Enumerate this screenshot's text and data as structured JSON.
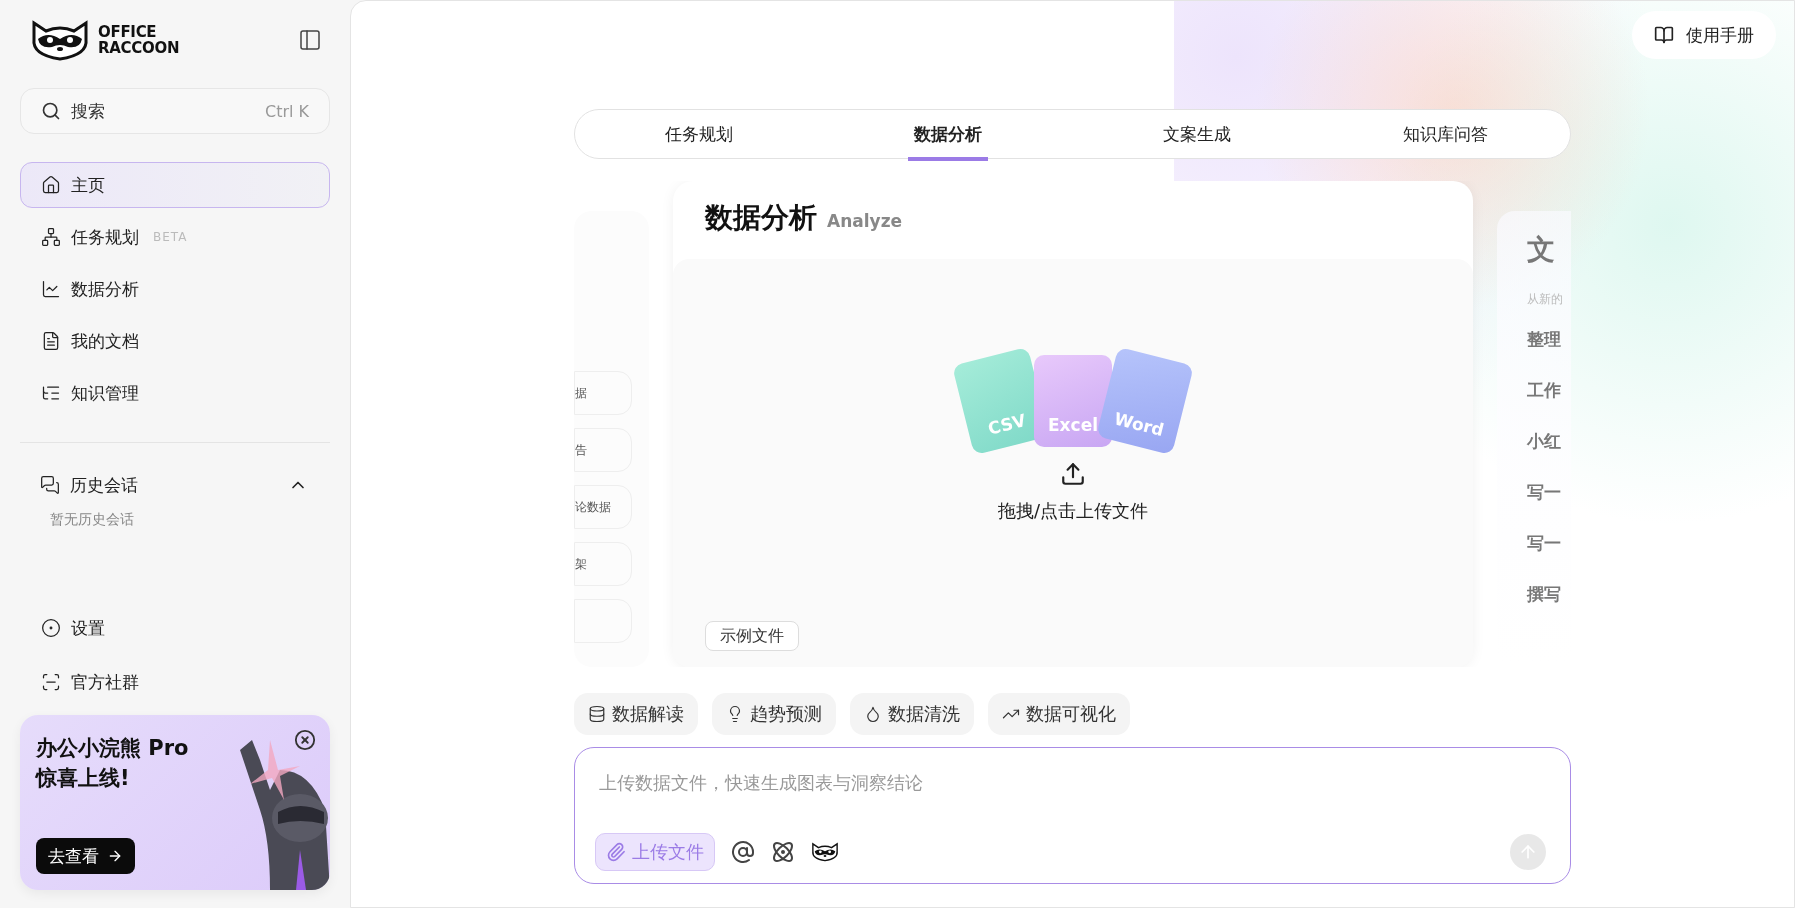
{
  "sidebar": {
    "logo": [
      "OFFICE",
      "RACCOON"
    ],
    "search": {
      "placeholder": "搜索",
      "shortcut": "Ctrl K"
    },
    "nav": [
      {
        "label": "主页",
        "selected": true
      },
      {
        "label": "任务规划",
        "selected": false,
        "badge": "BETA"
      },
      {
        "label": "数据分析",
        "selected": false
      },
      {
        "label": "我的文档",
        "selected": false
      },
      {
        "label": "知识管理",
        "selected": false
      }
    ],
    "history": {
      "title": "历史会话",
      "expanded": true,
      "empty_text": "暂无历史会话"
    },
    "bottom": [
      {
        "label": "设置"
      },
      {
        "label": "官方社群"
      }
    ],
    "promo": {
      "title_lines": [
        "办公小浣熊 Pro",
        "惊喜上线!"
      ],
      "button": "去查看"
    }
  },
  "manual_button": "使用手册",
  "tabs": [
    {
      "label": "任务规划",
      "selected": false
    },
    {
      "label": "数据分析",
      "selected": true
    },
    {
      "label": "文案生成",
      "selected": false
    },
    {
      "label": "知识库问答",
      "selected": false
    }
  ],
  "cards": {
    "left_items": [
      "据",
      "告",
      "论数据",
      "架"
    ],
    "center": {
      "title": "数据分析",
      "subtitle": "Analyze",
      "file_types": [
        "CSV",
        "Excel",
        "Word"
      ],
      "upload_text": "拖拽/点击上传文件",
      "sample_button": "示例文件"
    },
    "right": {
      "title": "文",
      "subtitle": "从新的",
      "items": [
        "整理",
        "工作",
        "小红",
        "写一",
        "写一",
        "撰写"
      ]
    }
  },
  "chips": [
    "数据解读",
    "趋势预测",
    "数据清洗",
    "数据可视化"
  ],
  "composer": {
    "placeholder": "上传数据文件，快速生成图表与洞察结论",
    "upload_button": "上传文件"
  }
}
